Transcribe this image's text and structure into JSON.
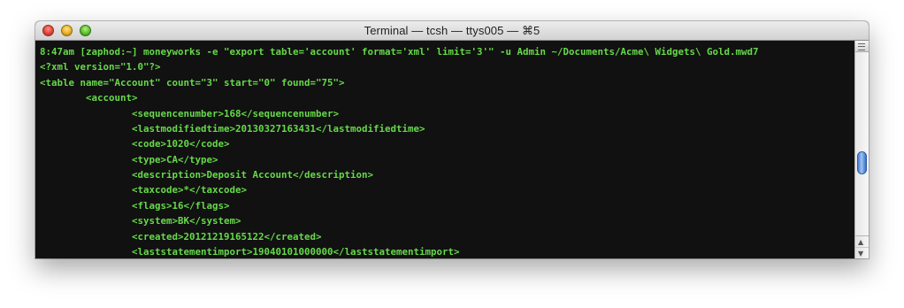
{
  "window": {
    "title": "Terminal — tcsh — ttys005 — ⌘5"
  },
  "terminal": {
    "text_color": "#66d94a",
    "background": "#111111",
    "lines": [
      "8:47am [zaphod:~] moneyworks -e \"export table='account' format='xml' limit='3'\" -u Admin ~/Documents/Acme\\ Widgets\\ Gold.mwd7",
      "<?xml version=\"1.0\"?>",
      "<table name=\"Account\" count=\"3\" start=\"0\" found=\"75\">",
      "        <account>",
      "                <sequencenumber>168</sequencenumber>",
      "                <lastmodifiedtime>20130327163431</lastmodifiedtime>",
      "                <code>1020</code>",
      "                <type>CA</type>",
      "                <description>Deposit Account</description>",
      "                <taxcode>*</taxcode>",
      "                <flags>16</flags>",
      "                <system>BK</system>",
      "                <created>20121219165122</created>",
      "                <laststatementimport>19040101000000</laststatementimport>"
    ]
  },
  "scrollbar": {
    "position_fraction": 0.62,
    "up_glyph": "▲",
    "down_glyph": "▼"
  },
  "icons": {
    "close": "close-icon",
    "minimize": "minimize-icon",
    "zoom": "zoom-icon",
    "split": "split-view-icon"
  }
}
